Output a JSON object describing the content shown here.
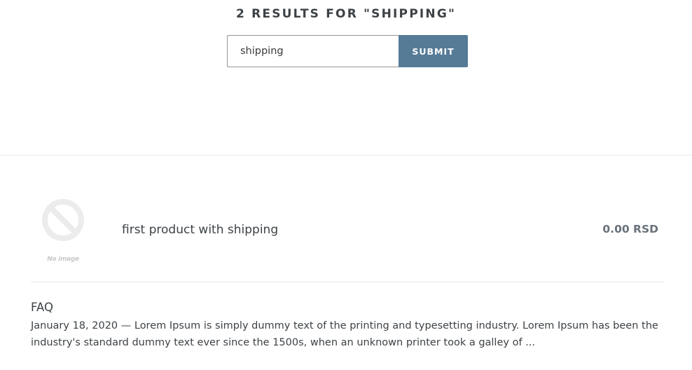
{
  "search": {
    "heading": "2 RESULTS FOR \"SHIPPING\"",
    "query": "shipping",
    "submit_label": "SUBMIT"
  },
  "results": {
    "product": {
      "image_placeholder": "No image",
      "title": "first product with shipping",
      "price": "0.00 RSD"
    },
    "article": {
      "title": "FAQ",
      "excerpt": "January 18, 2020 — Lorem Ipsum  is simply dummy text of the printing and typesetting industry. Lorem Ipsum has been the industry's standard dummy text ever since the 1500s, when an unknown printer took a galley of ..."
    }
  },
  "colors": {
    "accent": "#557b97",
    "text": "#3d4246",
    "price": "#69727b",
    "divider": "#e8e9eb",
    "placeholder_icon": "#ececec"
  },
  "icons": {
    "no_image": "no-image-icon"
  }
}
